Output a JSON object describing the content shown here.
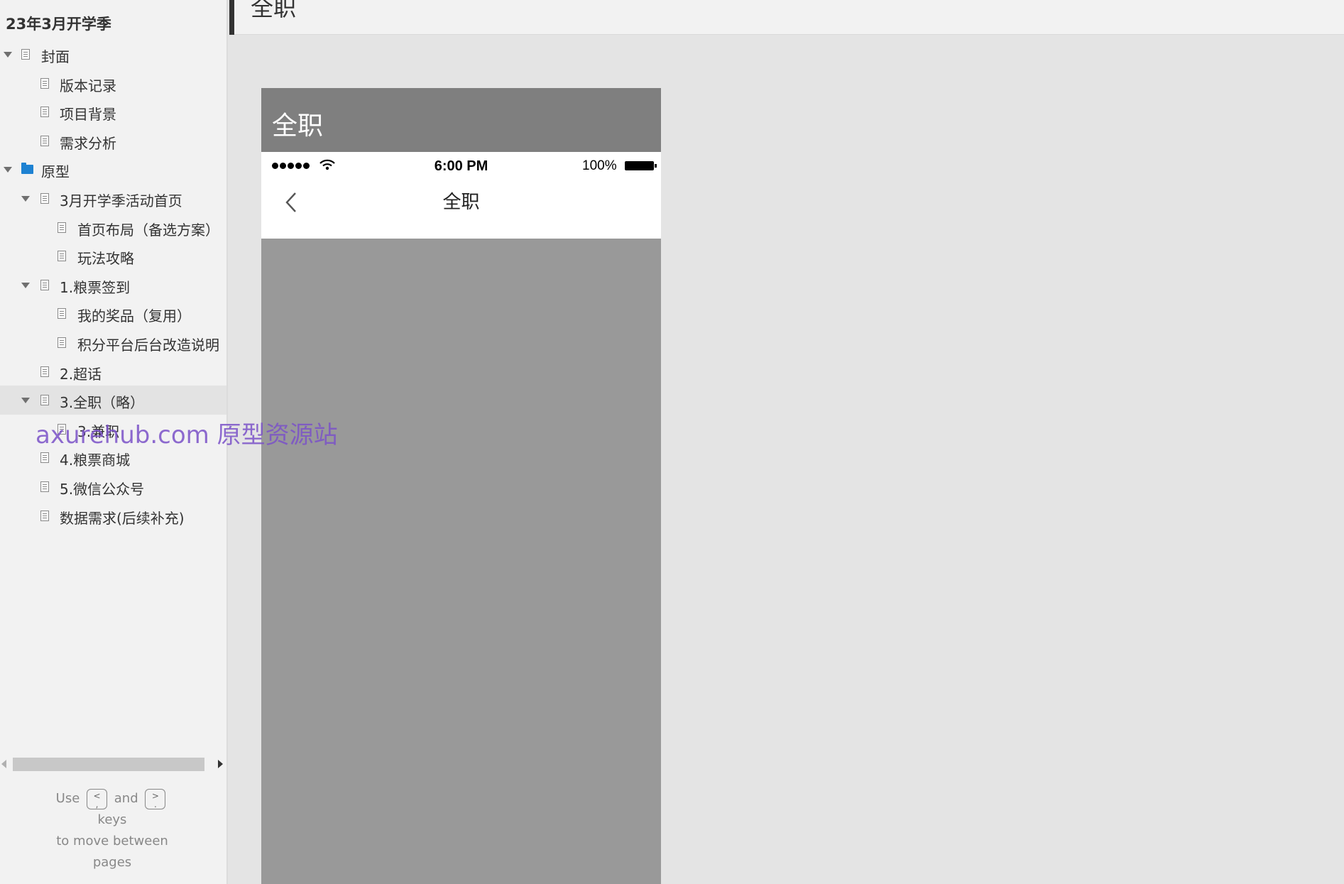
{
  "sidebar": {
    "project_title": "23年3月开学季",
    "tree": [
      {
        "label": "封面",
        "level": 0,
        "icon": "page-icon",
        "expanded": true,
        "selected": false
      },
      {
        "label": "版本记录",
        "level": 1,
        "icon": "page-icon",
        "expanded": null,
        "selected": false
      },
      {
        "label": "项目背景",
        "level": 1,
        "icon": "page-icon",
        "expanded": null,
        "selected": false
      },
      {
        "label": "需求分析",
        "level": 1,
        "icon": "page-icon",
        "expanded": null,
        "selected": false
      },
      {
        "label": "原型",
        "level": 0,
        "icon": "folder-icon",
        "expanded": true,
        "selected": false
      },
      {
        "label": "3月开学季活动首页",
        "level": 1,
        "icon": "page-icon",
        "expanded": true,
        "selected": false
      },
      {
        "label": "首页布局（备选方案）",
        "level": 2,
        "icon": "page-icon",
        "expanded": null,
        "selected": false
      },
      {
        "label": "玩法攻略",
        "level": 2,
        "icon": "page-icon",
        "expanded": null,
        "selected": false
      },
      {
        "label": "1.粮票签到",
        "level": 1,
        "icon": "page-icon",
        "expanded": true,
        "selected": false
      },
      {
        "label": "我的奖品（复用）",
        "level": 2,
        "icon": "page-icon",
        "expanded": null,
        "selected": false
      },
      {
        "label": "积分平台后台改造说明",
        "level": 2,
        "icon": "page-icon",
        "expanded": null,
        "selected": false
      },
      {
        "label": "2.超话",
        "level": 1,
        "icon": "page-icon",
        "expanded": null,
        "selected": false
      },
      {
        "label": "3.全职（略）",
        "level": 1,
        "icon": "page-icon",
        "expanded": true,
        "selected": true
      },
      {
        "label": "3.兼职",
        "level": 2,
        "icon": "page-icon",
        "expanded": null,
        "selected": false
      },
      {
        "label": "4.粮票商城",
        "level": 1,
        "icon": "page-icon",
        "expanded": null,
        "selected": false
      },
      {
        "label": "5.微信公众号",
        "level": 1,
        "icon": "page-icon",
        "expanded": null,
        "selected": false
      },
      {
        "label": "数据需求(后续补充)",
        "level": 1,
        "icon": "page-icon",
        "expanded": null,
        "selected": false
      }
    ],
    "hint": {
      "use": "Use",
      "prev_key": "<\n,",
      "and": "and",
      "next_key": ">\n.",
      "keys": "keys",
      "to_move": "to move between",
      "pages": "pages"
    }
  },
  "header": {
    "title": "全职"
  },
  "phone": {
    "banner_title": "全职",
    "status_time": "6:00 PM",
    "battery_percent": "100%",
    "nav_title": "全职"
  },
  "watermark": "axurehub.com 原型资源站",
  "colors": {
    "sidebar_bg": "#f2f2f2",
    "canvas_bg": "#e4e4e4",
    "banner_bg": "#7f7f7f",
    "phone_body_bg": "#999999",
    "folder_icon": "#1e82d2",
    "watermark": "#7b52c8"
  }
}
